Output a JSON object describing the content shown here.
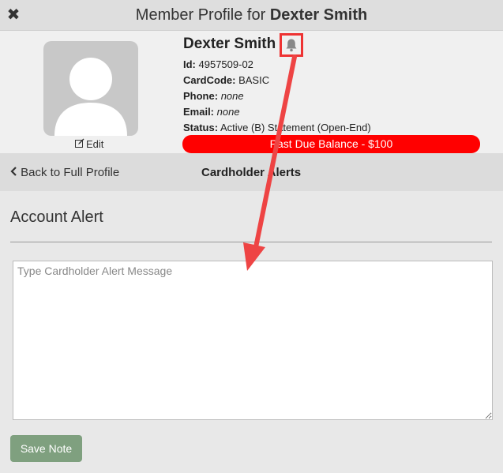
{
  "window": {
    "title_prefix": "Member Profile for ",
    "title_name": "Dexter Smith",
    "close_icon": "✖"
  },
  "profile": {
    "name": "Dexter Smith",
    "edit_label": "Edit",
    "id_label": "Id:",
    "id_value": "4957509-02",
    "cardcode_label": "CardCode:",
    "cardcode_value": "BASIC",
    "phone_label": "Phone:",
    "phone_value": "none",
    "email_label": "Email:",
    "email_value": "none",
    "status_label": "Status:",
    "status_value": "Active (B) Statement (Open-End)",
    "past_due": "Past Due Balance - $100"
  },
  "nav": {
    "back_label": "Back to Full Profile",
    "title": "Cardholder Alerts"
  },
  "alert_form": {
    "section_title": "Account Alert",
    "placeholder": "Type Cardholder Alert Message",
    "value": "",
    "save_label": "Save Note"
  },
  "colors": {
    "past_due_bg": "#ff0000",
    "save_button_bg": "#7fa07f",
    "annotation_red": "#ee3333"
  }
}
